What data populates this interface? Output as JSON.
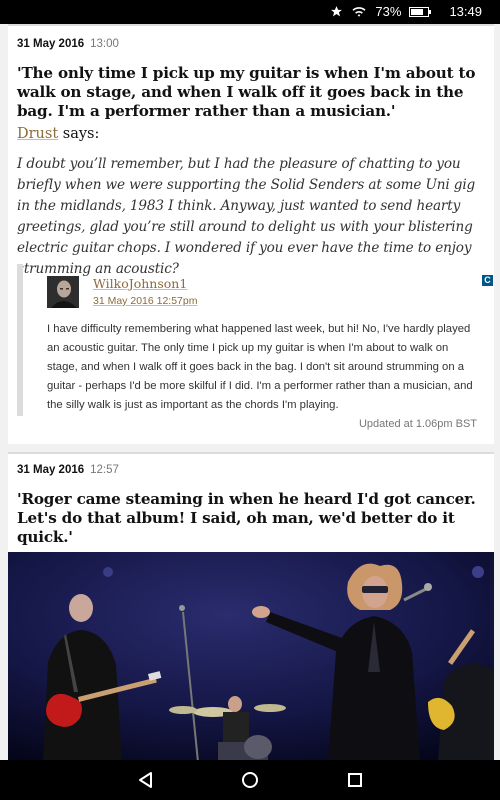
{
  "status_bar": {
    "battery_text": "73%",
    "battery_level": 0.73,
    "time": "13:49",
    "icons": [
      "star-icon",
      "wifi-icon",
      "battery-charging-icon"
    ]
  },
  "posts": [
    {
      "date": "31 May 2016",
      "time": "13:00",
      "headline": "'The only time I pick up my guitar is when I'm about to walk on stage, and when I walk off it goes back in the bag. I'm a performer rather than a musician.'",
      "commenter": "Drust",
      "says": "says:",
      "comment": "I doubt you’ll remember, but I had the pleasure of chatting to you briefly when we were supporting the Solid Senders at some Uni gig in the midlands, 1983 I think. Anyway, just wanted to send hearty greetings, glad you’re still around to delight us with your blistering electric guitar chops. I wondered if you ever have the time to enjoy strumming an acoustic?",
      "reply": {
        "name": "WilkoJohnson1",
        "date": "31 May 2016 12:57pm",
        "badge": "C",
        "body": "I have difficulty remembering what happened last week, but hi! No, I've hardly played an acoustic guitar. The only time I pick up my guitar is when I'm about to walk on stage, and when I walk off it goes back in the bag. I don't sit around strumming on a guitar - perhaps I'd be more skilful if I did. I'm a performer rather than a musician, and the silly walk is just as important as the chords I'm playing."
      },
      "updated": "Updated at 1.06pm BST"
    },
    {
      "date": "31 May 2016",
      "time": "12:57",
      "headline": "'Roger came steaming in when he heard I'd got cancer. Let's do that album! I said, oh man, we'd better do it quick.'"
    }
  ],
  "nav": {
    "buttons": [
      "back-icon",
      "home-icon",
      "recents-icon"
    ]
  }
}
